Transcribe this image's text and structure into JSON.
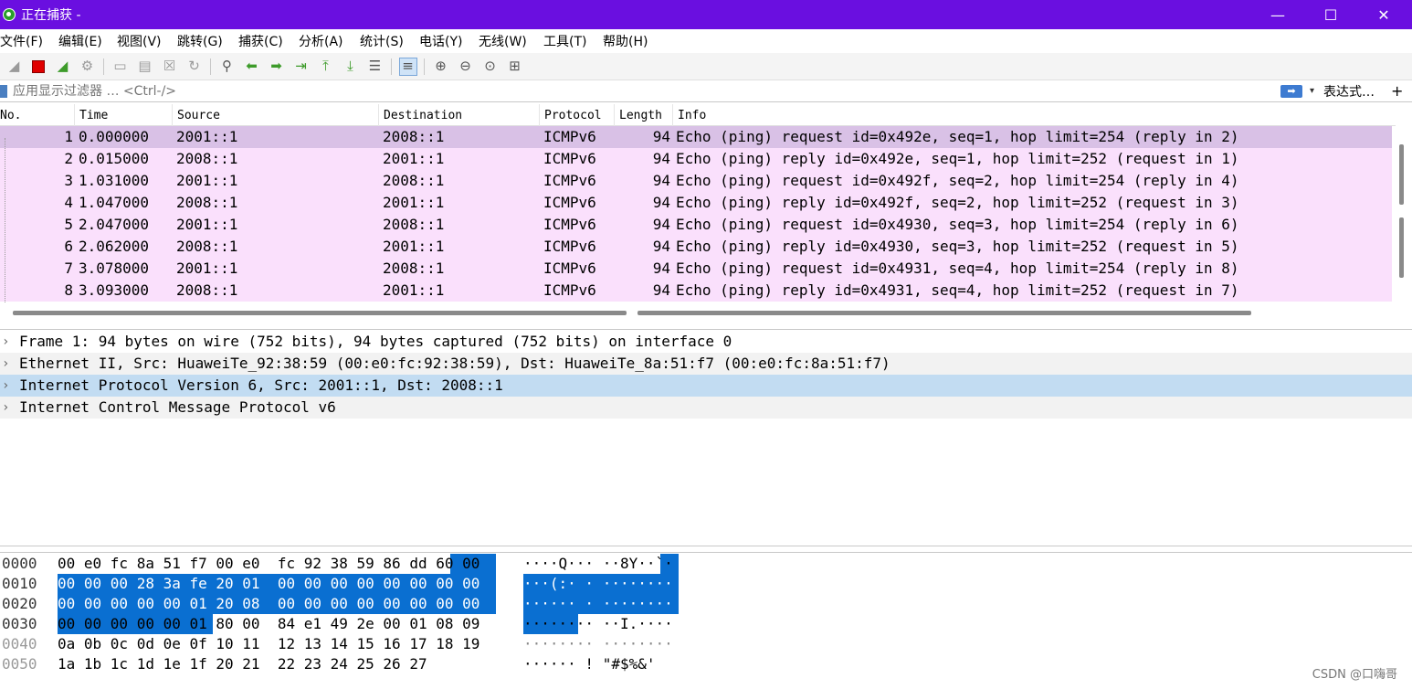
{
  "window": {
    "title": "正在捕获 -",
    "minimize": "—",
    "maximize": "☐",
    "close": "✕"
  },
  "menu": [
    "文件(F)",
    "编辑(E)",
    "视图(V)",
    "跳转(G)",
    "捕获(C)",
    "分析(A)",
    "统计(S)",
    "电话(Y)",
    "无线(W)",
    "工具(T)",
    "帮助(H)"
  ],
  "filter": {
    "placeholder": "应用显示过滤器 … <Ctrl-/>",
    "apply_glyph": "➡",
    "dropdown_glyph": "▾",
    "expression_label": "表达式…",
    "add_label": "+"
  },
  "columns": [
    "No.",
    "Time",
    "Source",
    "Destination",
    "Protocol",
    "Length",
    "Info"
  ],
  "packets": [
    {
      "no": "1",
      "time": "0.000000",
      "src": "2001::1",
      "dst": "2008::1",
      "proto": "ICMPv6",
      "len": "94",
      "info": "Echo (ping) request id=0x492e, seq=1, hop limit=254 (reply in 2)"
    },
    {
      "no": "2",
      "time": "0.015000",
      "src": "2008::1",
      "dst": "2001::1",
      "proto": "ICMPv6",
      "len": "94",
      "info": "Echo (ping) reply id=0x492e, seq=1, hop limit=252 (request in 1)"
    },
    {
      "no": "3",
      "time": "1.031000",
      "src": "2001::1",
      "dst": "2008::1",
      "proto": "ICMPv6",
      "len": "94",
      "info": "Echo (ping) request id=0x492f, seq=2, hop limit=254 (reply in 4)"
    },
    {
      "no": "4",
      "time": "1.047000",
      "src": "2008::1",
      "dst": "2001::1",
      "proto": "ICMPv6",
      "len": "94",
      "info": "Echo (ping) reply id=0x492f, seq=2, hop limit=252 (request in 3)"
    },
    {
      "no": "5",
      "time": "2.047000",
      "src": "2001::1",
      "dst": "2008::1",
      "proto": "ICMPv6",
      "len": "94",
      "info": "Echo (ping) request id=0x4930, seq=3, hop limit=254 (reply in 6)"
    },
    {
      "no": "6",
      "time": "2.062000",
      "src": "2008::1",
      "dst": "2001::1",
      "proto": "ICMPv6",
      "len": "94",
      "info": "Echo (ping) reply id=0x4930, seq=3, hop limit=252 (request in 5)"
    },
    {
      "no": "7",
      "time": "3.078000",
      "src": "2001::1",
      "dst": "2008::1",
      "proto": "ICMPv6",
      "len": "94",
      "info": "Echo (ping) request id=0x4931, seq=4, hop limit=254 (reply in 8)"
    },
    {
      "no": "8",
      "time": "3.093000",
      "src": "2008::1",
      "dst": "2001::1",
      "proto": "ICMPv6",
      "len": "94",
      "info": "Echo (ping) reply id=0x4931, seq=4, hop limit=252 (request in 7)"
    }
  ],
  "details": [
    "Frame 1: 94 bytes on wire (752 bits), 94 bytes captured (752 bits) on interface 0",
    "Ethernet II, Src: HuaweiTe_92:38:59 (00:e0:fc:92:38:59), Dst: HuaweiTe_8a:51:f7 (00:e0:fc:8a:51:f7)",
    "Internet Protocol Version 6, Src: 2001::1, Dst: 2008::1",
    "Internet Control Message Protocol v6"
  ],
  "bytes": [
    {
      "offset": "0000",
      "hex": "00 e0 fc 8a 51 f7 00 e0  fc 92 38 59 86 dd 60 00",
      "ascii": "····Q··· ··8Y··`·"
    },
    {
      "offset": "0010",
      "hex": "00 00 00 28 3a fe 20 01  00 00 00 00 00 00 00 00",
      "ascii": "···(:· · ········"
    },
    {
      "offset": "0020",
      "hex": "00 00 00 00 00 01 20 08  00 00 00 00 00 00 00 00",
      "ascii": "······ · ········"
    },
    {
      "offset": "0030",
      "hex": "00 00 00 00 00 01 80 00  84 e1 49 2e 00 01 08 09",
      "ascii": "········ ··I.····"
    },
    {
      "offset": "0040",
      "hex": "0a 0b 0c 0d 0e 0f 10 11  12 13 14 15 16 17 18 19",
      "ascii": "········ ········"
    },
    {
      "offset": "0050",
      "hex": "1a 1b 1c 1d 1e 1f 20 21  22 23 24 25 26 27",
      "ascii": "······ ! \"#$%&'"
    }
  ],
  "watermark": "CSDN @口嗨哥",
  "colors": {
    "titlebar": "#6a0fe0",
    "packet_row": "#fae0fc",
    "packet_selected": "#d9c1e6",
    "detail_selected": "#c2dcf2",
    "byte_highlight": "#0a6fd1"
  },
  "icons": [
    "shark-fin-icon",
    "stop-capture-icon",
    "restart-capture-icon",
    "capture-options-icon",
    "open-file-icon",
    "save-file-icon",
    "close-file-icon",
    "reload-file-icon",
    "find-packet-icon",
    "go-back-icon",
    "go-forward-icon",
    "go-to-packet-icon",
    "go-first-icon",
    "go-last-icon",
    "autoscroll-icon",
    "colorize-icon",
    "zoom-in-icon",
    "zoom-out-icon",
    "zoom-normal-icon",
    "resize-columns-icon"
  ]
}
